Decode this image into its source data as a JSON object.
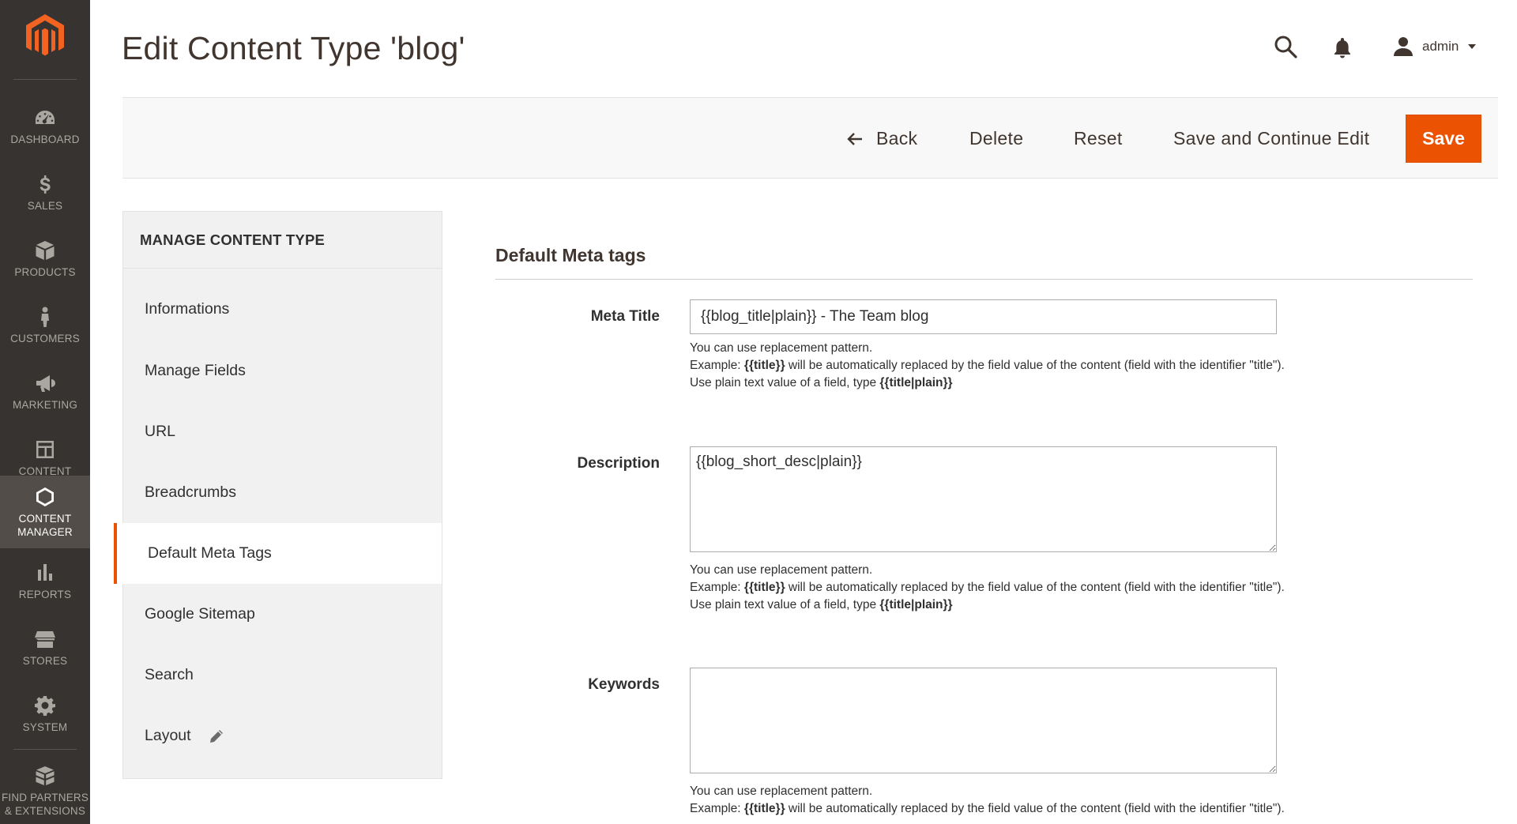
{
  "sidebar": {
    "items": [
      {
        "label": "DASHBOARD",
        "icon": "dashboard-icon"
      },
      {
        "label": "SALES",
        "icon": "dollar-icon"
      },
      {
        "label": "PRODUCTS",
        "icon": "box-icon"
      },
      {
        "label": "CUSTOMERS",
        "icon": "person-icon"
      },
      {
        "label": "MARKETING",
        "icon": "megaphone-icon"
      },
      {
        "label": "CONTENT",
        "icon": "layout-icon"
      },
      {
        "label": "CONTENT\nMANAGER",
        "icon": "hexagon-icon",
        "active": true
      },
      {
        "label": "REPORTS",
        "icon": "bar-chart-icon"
      },
      {
        "label": "STORES",
        "icon": "store-icon"
      },
      {
        "label": "SYSTEM",
        "icon": "gear-icon"
      },
      {
        "label": "FIND PARTNERS\n& EXTENSIONS",
        "icon": "box-stack-icon"
      }
    ]
  },
  "header": {
    "title": "Edit Content Type 'blog'",
    "user_name": "admin"
  },
  "toolbar": {
    "back_label": "Back",
    "delete_label": "Delete",
    "reset_label": "Reset",
    "save_continue_label": "Save and Continue Edit",
    "save_label": "Save"
  },
  "tabs": {
    "title": "MANAGE CONTENT TYPE",
    "items": [
      {
        "label": "Informations"
      },
      {
        "label": "Manage Fields"
      },
      {
        "label": "URL"
      },
      {
        "label": "Breadcrumbs"
      },
      {
        "label": "Default Meta Tags",
        "active": true
      },
      {
        "label": "Google Sitemap"
      },
      {
        "label": "Search"
      },
      {
        "label": "Layout"
      }
    ]
  },
  "section": {
    "title": "Default Meta tags"
  },
  "fields": {
    "meta_title": {
      "label": "Meta Title",
      "value": "{{blog_title|plain}} - The Team blog"
    },
    "description": {
      "label": "Description",
      "value": "{{blog_short_desc|plain}}"
    },
    "keywords": {
      "label": "Keywords",
      "value": ""
    }
  },
  "note": {
    "line1": "You can use replacement pattern.",
    "example_prefix": "Example: ",
    "example_token": "{{title}}",
    "example_suffix": " will be automatically replaced by the field value of the content (field with the identifier \"title\").",
    "plain_prefix": "Use plain text value of a field, type ",
    "plain_token": "{{title|plain}}"
  },
  "colors": {
    "sidebar_bg": "#373330",
    "accent": "#eb5202",
    "logo": "#f26322"
  }
}
